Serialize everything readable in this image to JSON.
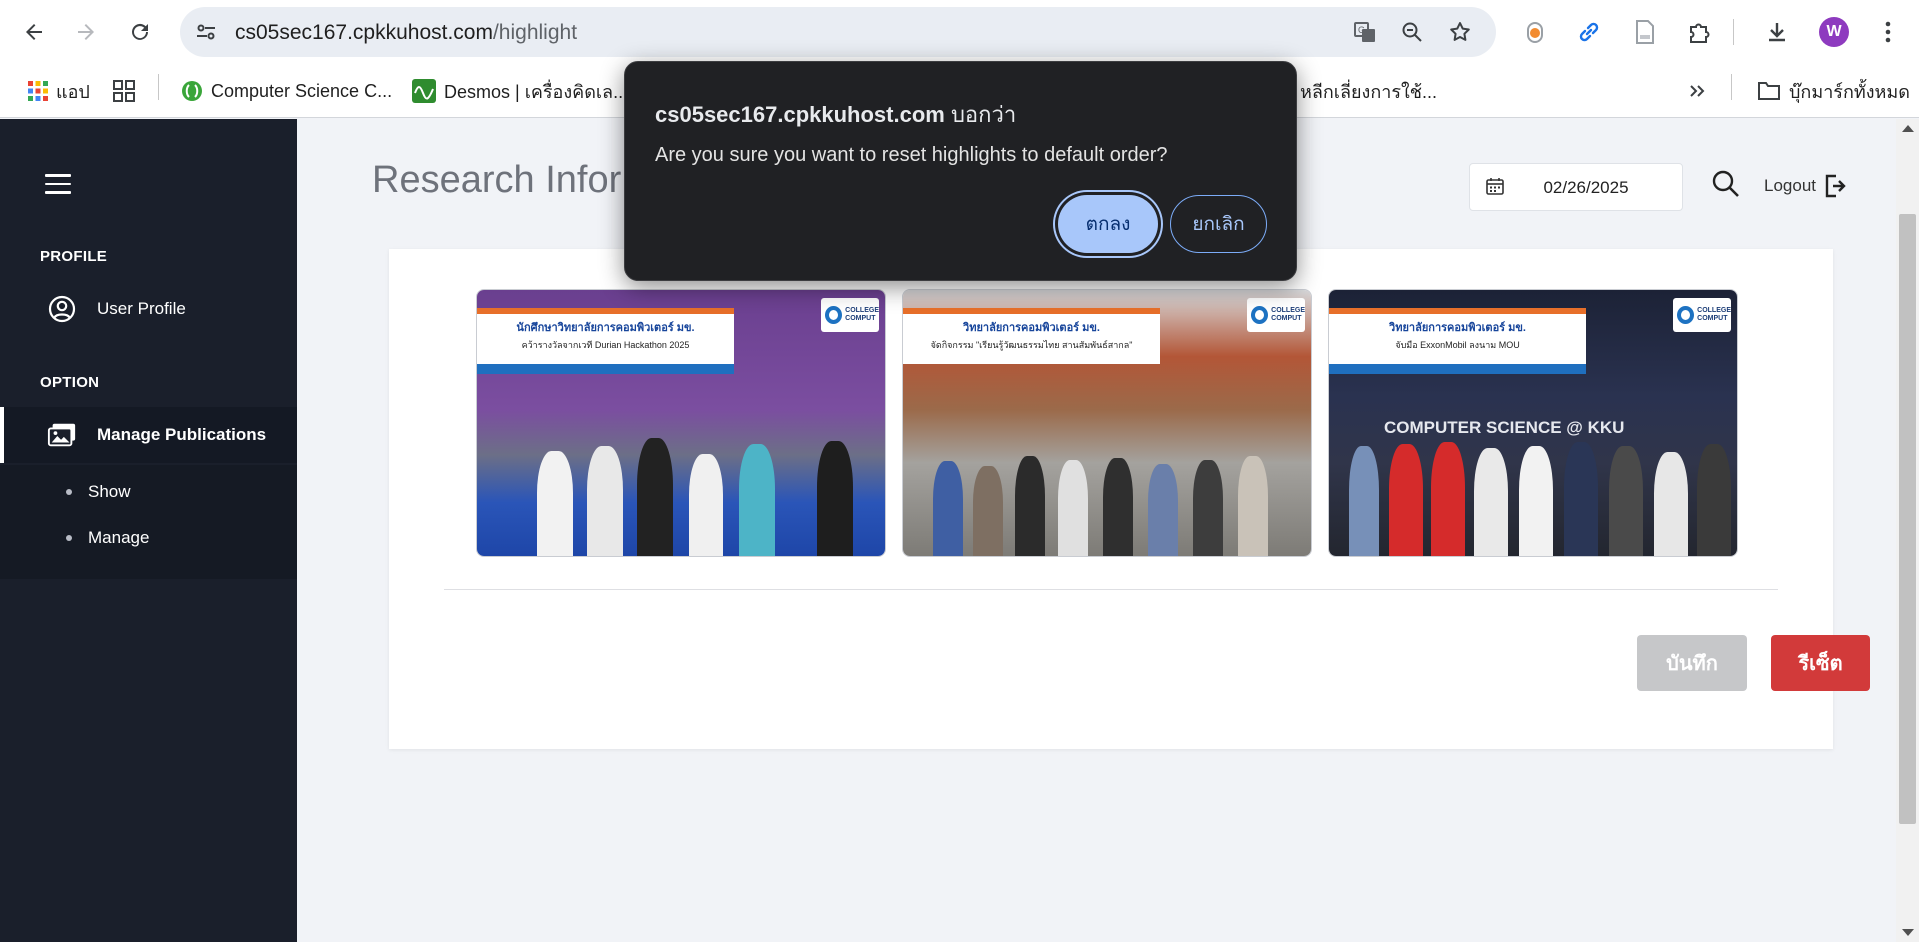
{
  "browser": {
    "url_host": "cs05sec167.cpkkuhost.com",
    "url_path": "/highlight",
    "avatar_letter": "W",
    "bookmarks": [
      {
        "label": "แอป",
        "icon": "apps-grid-icon"
      },
      {
        "label": "",
        "icon": "tab-groups-icon"
      },
      {
        "label": "Computer Science C...",
        "icon": "green-bracket-favicon"
      },
      {
        "label": "Desmos | เครื่องคิดเล...",
        "icon": "desmos-favicon"
      },
      {
        "label": ":: หลีกเลี่ยงการใช้...",
        "icon": ""
      }
    ],
    "all_bookmarks_label": "บุ๊กมาร์กทั้งหมด"
  },
  "sidebar": {
    "profile_section": "PROFILE",
    "user_profile": "User Profile",
    "option_section": "OPTION",
    "manage_publications": "Manage Publications",
    "sub_items": [
      "Show",
      "Manage"
    ]
  },
  "main": {
    "page_title": "Research Infor",
    "date_value": "02/26/2025",
    "logout_label": "Logout",
    "highlights": [
      {
        "headline": "นักศึกษาวิทยาลัยการคอมพิวเตอร์ มข.",
        "subline": "คว้ารางวัลจากเวที Durian Hackathon 2025",
        "tag": "2025"
      },
      {
        "headline": "วิทยาลัยการคอมพิวเตอร์ มข.",
        "subline": "จัดกิจกรรม \"เรียนรู้วัฒนธรรมไทย สานสัมพันธ์สากล\"",
        "tag": ""
      },
      {
        "headline": "วิทยาลัยการคอมพิวเตอร์ มข.",
        "subline": "จับมือ ExxonMobil ลงนาม MOU",
        "tag": "COMPUTER SCIENCE @ KKU"
      }
    ],
    "save_button": "บันทึก",
    "reset_button": "รีเซ็ต"
  },
  "dialog": {
    "origin": "cs05sec167.cpkkuhost.com",
    "says": "บอกว่า",
    "message": "Are you sure you want to reset highlights to default order?",
    "ok_label": "ตกลง",
    "cancel_label": "ยกเลิก"
  },
  "colors": {
    "sidebar_bg": "#1a1f2b",
    "reset_red": "#d23a3a",
    "dialog_bg": "#202124",
    "dialog_accent": "#a8c7fa"
  }
}
